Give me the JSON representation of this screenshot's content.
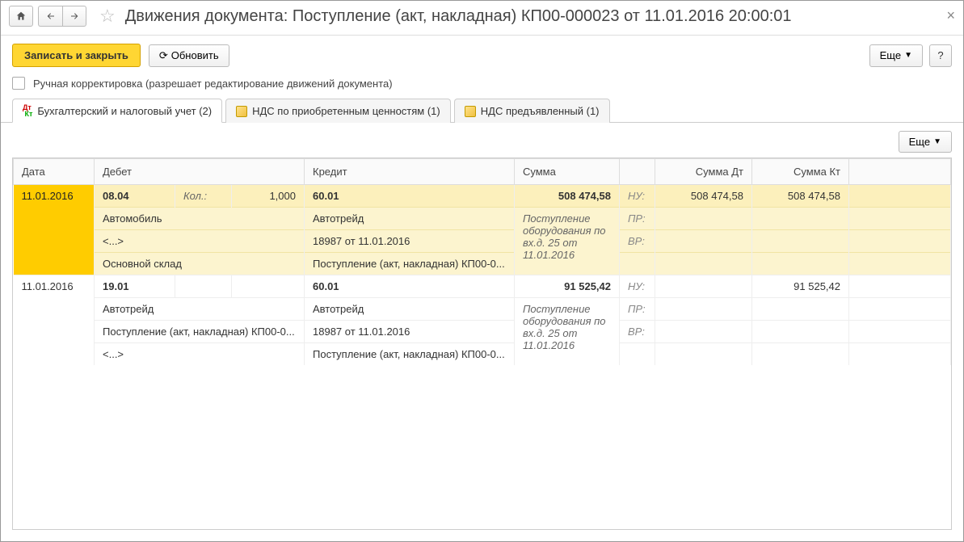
{
  "header": {
    "title": "Движения документа: Поступление (акт, накладная) КП00-000023 от 11.01.2016 20:00:01"
  },
  "toolbar": {
    "save_close": "Записать и закрыть",
    "refresh": "Обновить",
    "more": "Еще",
    "help": "?"
  },
  "manual_edit": {
    "label": "Ручная корректировка (разрешает редактирование движений документа)",
    "checked": false
  },
  "tabs": [
    {
      "label": "Бухгалтерский и налоговый учет (2)",
      "active": true
    },
    {
      "label": "НДС по приобретенным ценностям (1)",
      "active": false
    },
    {
      "label": "НДС предъявленный (1)",
      "active": false
    }
  ],
  "inner": {
    "more": "Еще"
  },
  "columns": {
    "date": "Дата",
    "debit": "Дебет",
    "credit": "Кредит",
    "sum": "Сумма",
    "sum_dt": "Сумма Дт",
    "sum_kt": "Сумма Кт"
  },
  "rows": [
    {
      "selected": true,
      "date": "11.01.2016",
      "debit_account": "08.04",
      "qty_label": "Кол.:",
      "qty": "1,000",
      "debit_lines": [
        "Автомобиль",
        "<...>",
        "Основной склад"
      ],
      "credit_account": "60.01",
      "credit_lines": [
        "Автотрейд",
        "18987 от 11.01.2016",
        "Поступление (акт, накладная) КП00-0..."
      ],
      "sum": "508 474,58",
      "description": "Поступление оборудования по вх.д. 25 от 11.01.2016",
      "tags": [
        "НУ:",
        "ПР:",
        "ВР:"
      ],
      "sum_dt": "508 474,58",
      "sum_kt": "508 474,58"
    },
    {
      "selected": false,
      "date": "11.01.2016",
      "debit_account": "19.01",
      "qty_label": "",
      "qty": "",
      "debit_lines": [
        "Автотрейд",
        "Поступление (акт, накладная) КП00-0...",
        "<...>"
      ],
      "credit_account": "60.01",
      "credit_lines": [
        "Автотрейд",
        "18987 от 11.01.2016",
        "Поступление (акт, накладная) КП00-0..."
      ],
      "sum": "91 525,42",
      "description": "Поступление оборудования по вх.д. 25 от 11.01.2016",
      "tags": [
        "НУ:",
        "ПР:",
        "ВР:"
      ],
      "sum_dt": "",
      "sum_kt": "91 525,42"
    }
  ]
}
